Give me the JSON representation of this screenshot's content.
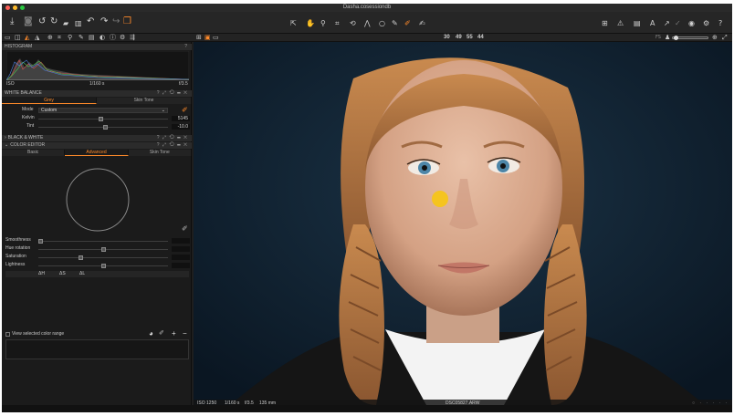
{
  "window": {
    "title": "Dasha.cosessiondb"
  },
  "colors": {
    "accent": "#ff8a2a",
    "picker": "#f5c518",
    "close": "#ff5f57",
    "minimize": "#febc2e",
    "zoom": "#28c840"
  },
  "toolbar": {
    "left_icons": [
      "download-icon",
      "camera-icon",
      "rotate-icon",
      "refresh-icon",
      "import-icon",
      "trash-icon",
      "undo-icon",
      "redo-icon",
      "forward-icon",
      "layers-icon"
    ],
    "center_icons": [
      "cursor-icon",
      "pan-icon",
      "zoom-icon",
      "crop-icon",
      "rotate-tool-icon",
      "keystone-icon",
      "circle-icon",
      "brush-icon",
      "picker-icon",
      "annotate-icon"
    ],
    "right_icons": [
      "grid-icon",
      "warning-icon",
      "list-icon",
      "text-icon",
      "cursor-arrow-icon",
      "check-icon",
      "share-icon",
      "gear-icon",
      "help-icon"
    ]
  },
  "subbar": {
    "magnifier_values": [
      {
        "text": "30",
        "color": "#ff8a2a"
      },
      {
        "text": "49",
        "color": "#7fd45a"
      },
      {
        "text": "55",
        "color": "#6aa0ff"
      },
      {
        "text": "44",
        "color": "#aaaaaa"
      }
    ],
    "right_label": "FS"
  },
  "histogram": {
    "title": "HISTOGRAM",
    "iso": "ISO",
    "shutter": "1/160 s",
    "aperture": "f/3.5"
  },
  "white_balance": {
    "title": "WHITE BALANCE",
    "tabs": [
      "Grey",
      "Skin Tone"
    ],
    "mode_label": "Mode",
    "mode_value": "Custom",
    "kelvin_label": "Kelvin",
    "kelvin_value": "5145",
    "kelvin_level": 0.48,
    "tint_label": "Tint",
    "tint_value": "-10.0",
    "tint_level": 0.52
  },
  "black_white": {
    "title": "BLACK & WHITE"
  },
  "color_editor": {
    "title": "COLOR EDITOR",
    "tabs": [
      "Basic",
      "Advanced",
      "Skin Tone"
    ],
    "sliders": [
      {
        "label": "Smoothness",
        "level": 0.0
      },
      {
        "label": "Hue rotation",
        "level": 0.5
      },
      {
        "label": "Saturation",
        "level": 0.32
      },
      {
        "label": "Lightness",
        "level": 0.5
      }
    ],
    "delta_labels": [
      "ΔH",
      "ΔS",
      "ΔL"
    ],
    "view_range_label": "View selected color range"
  },
  "status": {
    "iso": "ISO 1250",
    "shutter": "1/160 s",
    "aperture": "f/3.5",
    "focal": "135 mm",
    "filename": "DSC05827.ARW"
  }
}
